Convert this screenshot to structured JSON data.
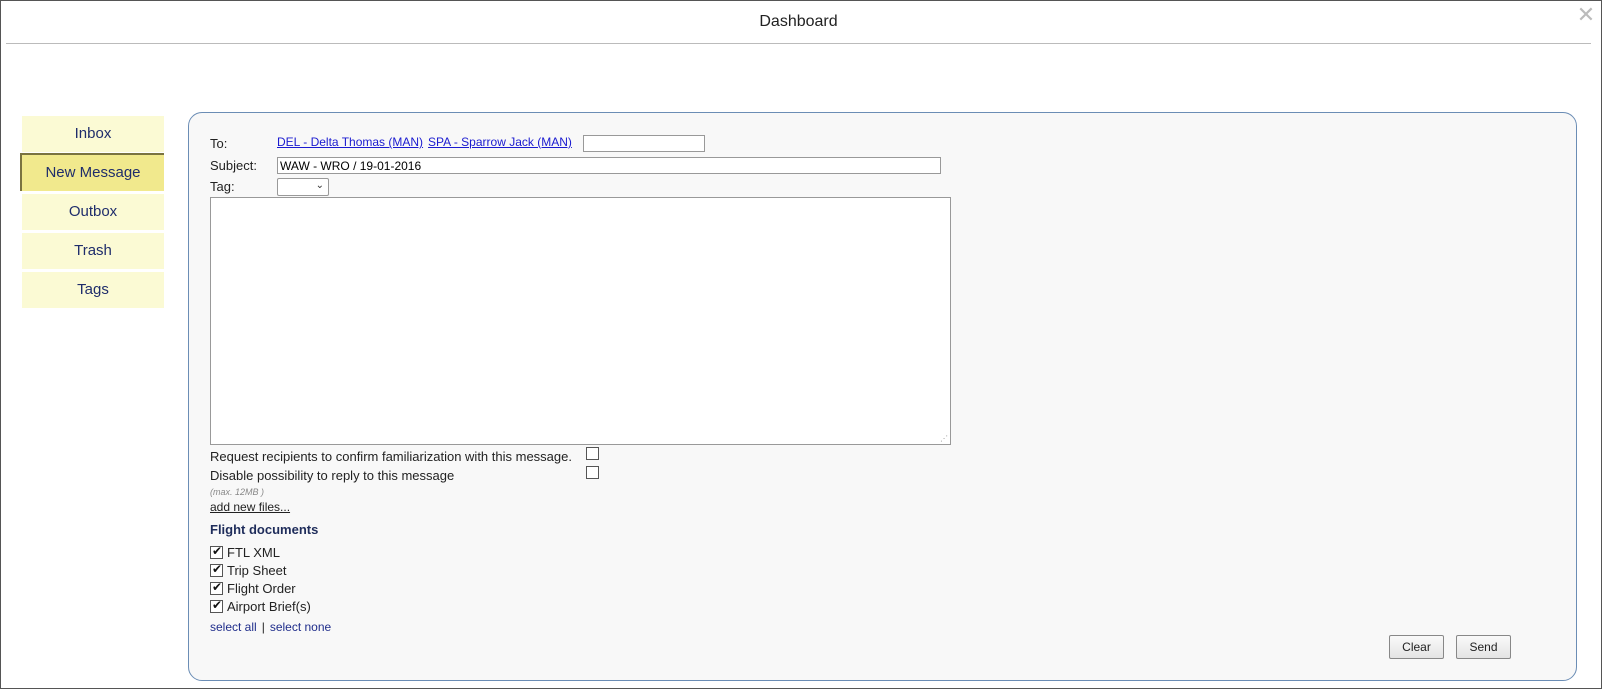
{
  "window": {
    "title": "Dashboard"
  },
  "sidebar": {
    "items": [
      {
        "label": "Inbox"
      },
      {
        "label": "New Message",
        "active": true
      },
      {
        "label": "Outbox"
      },
      {
        "label": "Trash"
      },
      {
        "label": "Tags"
      }
    ]
  },
  "form": {
    "to_label": "To:",
    "recipients": [
      "DEL - Delta Thomas (MAN)",
      "SPA - Sparrow Jack (MAN)"
    ],
    "to_input_value": "",
    "subject_label": "Subject:",
    "subject_value": "WAW - WRO / 19-01-2016",
    "tag_label": "Tag:",
    "tag_value": "",
    "body_value": "",
    "confirm_label": "Request recipients to confirm familiarization with this message.",
    "confirm_checked": false,
    "disable_reply_label": "Disable possibility to reply to this message",
    "disable_reply_checked": false,
    "max_note": "(max. 12MB )",
    "add_files": "add new files...",
    "flight_docs_title": "Flight documents",
    "flight_docs": [
      {
        "label": "FTL XML",
        "checked": true
      },
      {
        "label": "Trip Sheet",
        "checked": true
      },
      {
        "label": "Flight Order",
        "checked": true
      },
      {
        "label": "Airport Brief(s)",
        "checked": true
      }
    ],
    "select_all": "select all",
    "select_separator": "|",
    "select_none": "select none",
    "clear_label": "Clear",
    "send_label": "Send"
  },
  "colors": {
    "sidebar_bg": "#fbfad4",
    "sidebar_active_bg": "#f1e98d",
    "sidebar_text": "#1f2d6b",
    "panel_border": "#6b8db5",
    "link": "#1a1ad0"
  },
  "icons": {
    "close": "close-icon",
    "dropdown": "chevron-down-icon"
  }
}
